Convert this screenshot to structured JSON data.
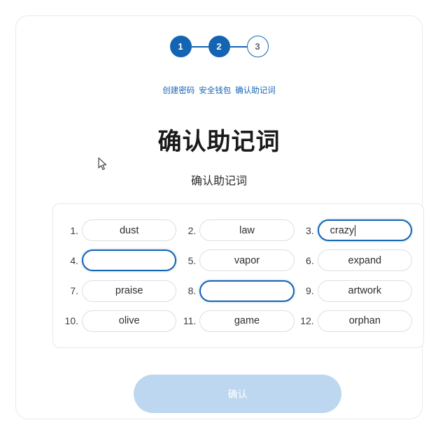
{
  "stepper": {
    "steps": [
      {
        "number": "1",
        "label": "创建密码",
        "state": "done"
      },
      {
        "number": "2",
        "label": "安全钱包",
        "state": "done"
      },
      {
        "number": "3",
        "label": "确认助记词",
        "state": "todo"
      }
    ],
    "accent_color": "#1464b4"
  },
  "page": {
    "title": "确认助记词",
    "subtitle": "确认助记词"
  },
  "words": [
    {
      "index": "1.",
      "value": "dust",
      "state": "filled"
    },
    {
      "index": "2.",
      "value": "law",
      "state": "filled"
    },
    {
      "index": "3.",
      "value": "crazy",
      "state": "focused-typed"
    },
    {
      "index": "4.",
      "value": "",
      "state": "focused-empty"
    },
    {
      "index": "5.",
      "value": "vapor",
      "state": "filled"
    },
    {
      "index": "6.",
      "value": "expand",
      "state": "filled"
    },
    {
      "index": "7.",
      "value": "praise",
      "state": "filled"
    },
    {
      "index": "8.",
      "value": "",
      "state": "focused-empty"
    },
    {
      "index": "9.",
      "value": "artwork",
      "state": "filled"
    },
    {
      "index": "10.",
      "value": "olive",
      "state": "filled"
    },
    {
      "index": "11.",
      "value": "game",
      "state": "filled"
    },
    {
      "index": "12.",
      "value": "orphan",
      "state": "filled"
    }
  ],
  "confirm_button": {
    "label": "确认",
    "disabled": true,
    "background": "#bdd7f0",
    "text_color": "#ffffff"
  }
}
